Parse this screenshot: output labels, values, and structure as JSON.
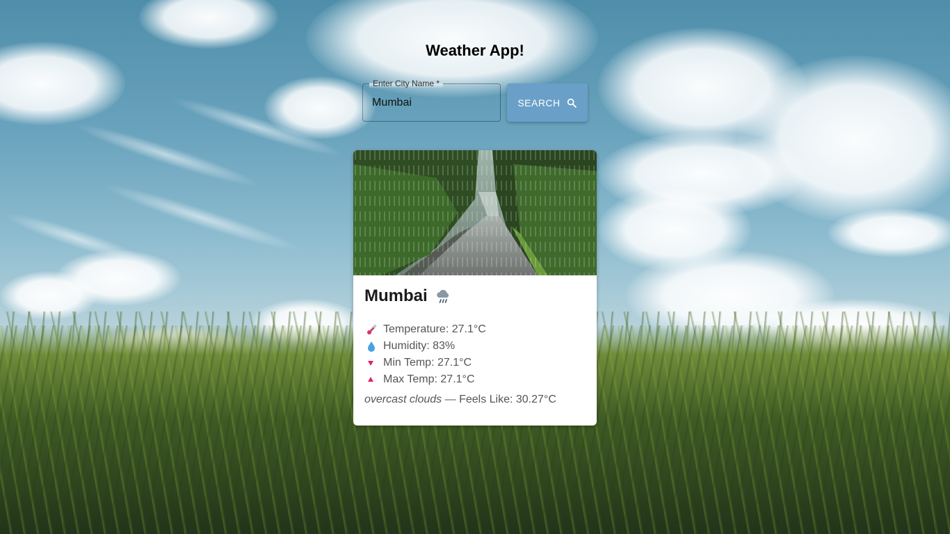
{
  "app": {
    "title": "Weather App!"
  },
  "search": {
    "label": "Enter City Name *",
    "value": "Mumbai",
    "button_label": "SEARCH",
    "button_icon": "search-icon",
    "button_color": "#6a9fc8"
  },
  "card": {
    "image": "rainy-road-forest-image",
    "city": "Mumbai",
    "condition_icon": "rain-cloud-icon",
    "stats": [
      {
        "icon": "thermometer-icon",
        "text": "Temperature: 27.1°C"
      },
      {
        "icon": "droplet-icon",
        "text": "Humidity: 83%"
      },
      {
        "icon": "down-triangle-icon",
        "text": "Min Temp: 27.1°C"
      },
      {
        "icon": "up-triangle-icon",
        "text": "Max Temp: 27.1°C"
      }
    ],
    "description": "overcast clouds",
    "feels_like": " — Feels Like: 30.27°C"
  },
  "colors": {
    "accent_triangle": "#e0245e",
    "droplet": "#4aa3df"
  }
}
